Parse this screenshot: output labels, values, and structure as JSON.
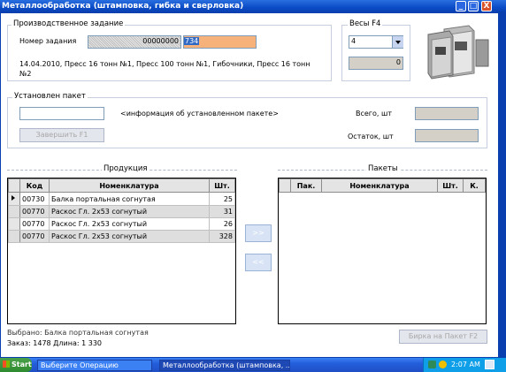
{
  "window": {
    "title": "Металлообработка (штамповка, гибка и сверловка)",
    "minimize": "_",
    "maximize": "□",
    "close": "X"
  },
  "production_task": {
    "group_label": "Производственное задание",
    "task_number_label": "Номер задания",
    "task_number_value": "00000000",
    "task_number_suffix": "734",
    "description": "14.04.2010, Пресс 16 тонн №1, Пресс 100 тонн №1, Гибочники, Пресс 16 тонн №2"
  },
  "scales": {
    "group_label": "Весы  F4",
    "selected": "4",
    "value": "0"
  },
  "package": {
    "group_label": "Установлен пакет",
    "info_text": "<информация об установленном пакете>",
    "complete_button": "Завершить     F1",
    "total_label": "Всего, шт",
    "remaining_label": "Остаток, шт"
  },
  "products": {
    "section_label": "Продукция",
    "columns": [
      "Код",
      "Номенклатура",
      "Шт."
    ],
    "rows": [
      {
        "code": "00730",
        "name": "Балка портальная согнутая",
        "qty": "25"
      },
      {
        "code": "00770",
        "name": "Раскос Гл. 2х53 согнутый",
        "qty": "31"
      },
      {
        "code": "00770",
        "name": "Раскос Гл. 2х53 согнутый",
        "qty": "26"
      },
      {
        "code": "00770",
        "name": "Раскос Гл. 2х53 согнутый",
        "qty": "328"
      }
    ]
  },
  "transfer": {
    "right": ">>",
    "left": "<<"
  },
  "packages": {
    "section_label": "Пакеты",
    "columns": [
      "Пак.",
      "Номенклатура",
      "Шт.",
      "К."
    ]
  },
  "footer": {
    "selected_text": "Выбрано: Балка портальная согнутая",
    "order_text": "Заказ: 1478  Длина: 1 330",
    "tag_button": "Бирка на Пакет   F2"
  },
  "taskbar": {
    "start": "Start",
    "task1": "Выберите Операцию",
    "task2": "Металлообработка (штамповка, ...",
    "clock": "2:07 AM"
  }
}
